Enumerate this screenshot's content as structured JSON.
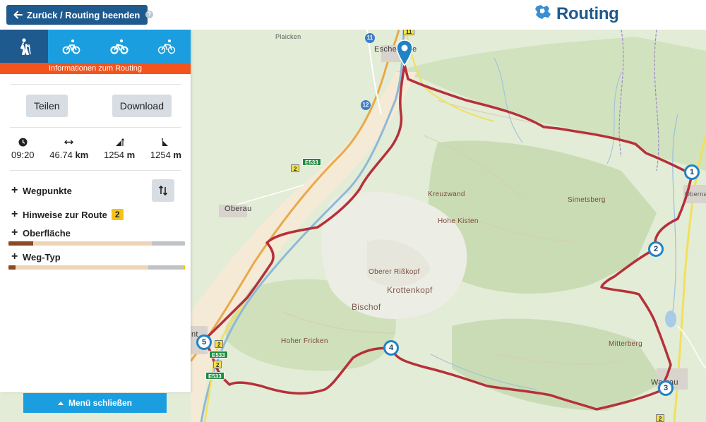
{
  "topbar": {
    "back_label": "Zurück / Routing beenden",
    "help_icon": "question-icon",
    "brand_title": "Routing",
    "brand_color": "#1f5a8e"
  },
  "panel": {
    "modes": [
      {
        "name": "hiking",
        "icon": "hiking-icon",
        "active": true
      },
      {
        "name": "cycling",
        "icon": "bicycle-icon",
        "active": false
      },
      {
        "name": "mountain-bike",
        "icon": "mountain-bike-icon",
        "active": false
      },
      {
        "name": "road-bike",
        "icon": "road-bike-icon",
        "active": false
      }
    ],
    "info_label": "Informationen zum Routing",
    "share_label": "Teilen",
    "download_label": "Download",
    "stats": {
      "duration": "09:20",
      "distance_value": "46.74",
      "distance_unit": "km",
      "ascent_value": "1254",
      "ascent_unit": "m",
      "descent_value": "1254",
      "descent_unit": "m"
    },
    "sections": {
      "waypoints": "Wegpunkte",
      "hints": "Hinweise zur Route",
      "hints_count": "2",
      "surface": "Oberfläche",
      "waytype": "Weg-Typ"
    },
    "surface_bar": [
      {
        "color": "#8b4a24",
        "fraction": 0.14
      },
      {
        "color": "#efd5b8",
        "fraction": 0.67
      },
      {
        "color": "#bfc3c6",
        "fraction": 0.19
      }
    ],
    "waytype_bar": [
      {
        "color": "#8b4a24",
        "fraction": 0.04
      },
      {
        "color": "#efd5b8",
        "fraction": 0.75
      },
      {
        "color": "#bfc3c6",
        "fraction": 0.2
      },
      {
        "color": "#f5c218",
        "fraction": 0.01
      }
    ],
    "menu_close_label": "Menü schließen"
  },
  "map": {
    "labels": {
      "plaicken": "Plaicken",
      "eschenlohe": "Esche",
      "eschenlohe_tail": "e",
      "oberau": "Oberau",
      "kreuzwand": "Kreuzwand",
      "hohe_kisten": "Hohe Kisten",
      "simetsberg": "Simetsberg",
      "oberer_risskopf": "Oberer Rißkopf",
      "krottenkopf": "Krottenkopf",
      "bischof": "Bischof",
      "hoher_fricken": "Hoher Fricken",
      "mitterberg": "Mitterberg",
      "oberna": "Oberna",
      "wallgau": "Wa",
      "wallgau_tail": "rau",
      "town_left": "nt"
    },
    "shields": {
      "e533_a": "E533",
      "e533_b": "E533",
      "e533_c": "E533",
      "b2_a": "2",
      "b2_b": "2",
      "b2_c": "2",
      "b2_d": "2",
      "a95": "12",
      "b11": "11",
      "b11_b": "11"
    },
    "waypoints": [
      "1",
      "2",
      "3",
      "4",
      "5"
    ],
    "route_color": "#b5303a",
    "start_pin_icon": "location-pin-icon"
  }
}
